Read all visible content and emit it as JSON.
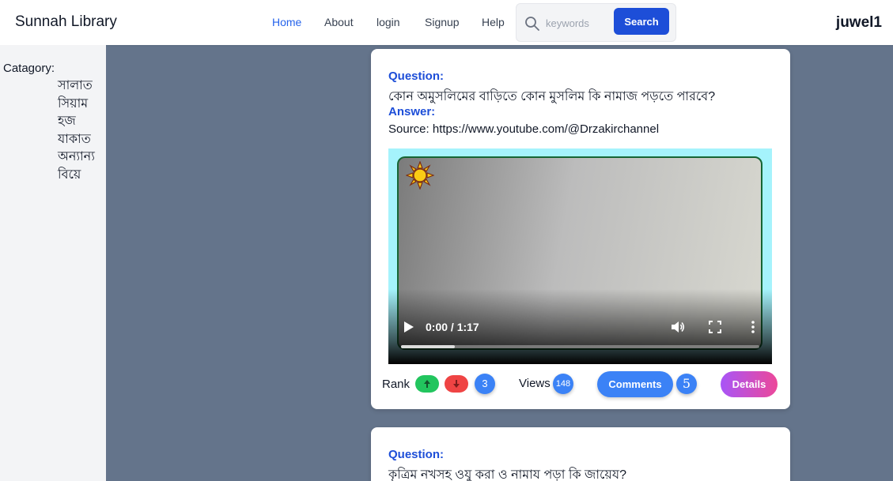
{
  "header": {
    "brand": "Sunnah Library",
    "nav": [
      {
        "label": "Home",
        "active": true
      },
      {
        "label": "About",
        "active": false
      },
      {
        "label": "login",
        "active": false
      },
      {
        "label": "Signup",
        "active": false
      },
      {
        "label": "Help",
        "active": false
      }
    ],
    "search": {
      "placeholder": "keywords",
      "value": "",
      "button_label": "Search",
      "icon": "search-icon"
    },
    "username": "juwel1"
  },
  "sidebar": {
    "title": "Catagory:",
    "categories": [
      "সালাত",
      "সিয়াম",
      "হজ",
      "যাকাত",
      "অন্যান্য",
      "বিয়ে"
    ]
  },
  "posts": [
    {
      "question_label": "Question:",
      "question": "কোন অমুসলিমের বাড়িতে কোন মুসলিম কি নামাজ পড়তে পারবে?",
      "answer_label": "Answer:",
      "source": "Source: https://www.youtube.com/@Drzakirchannel",
      "video": {
        "time": "0:00 / 1:17",
        "buffered_fraction": 0.15
      },
      "rank_label": "Rank",
      "rank": "3",
      "views_label": "Views",
      "views": "148",
      "comments_label": "Comments",
      "comments": "5",
      "details_label": "Details"
    },
    {
      "question_label": "Question:",
      "question": "কৃত্রিম নখসহ ওযু করা ও নামায পড়া কি জায়েয?"
    }
  ],
  "colors": {
    "page_background": "#64748b",
    "accent": "#1d4ed8",
    "vote_up": "#22c55e",
    "vote_down": "#ef4444",
    "badge": "#3b82f6"
  }
}
